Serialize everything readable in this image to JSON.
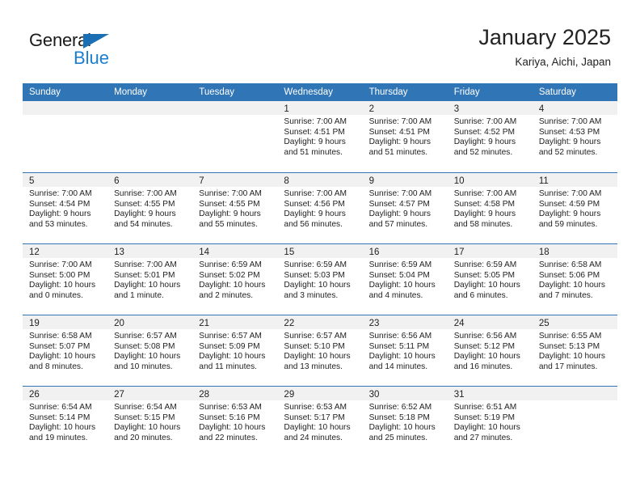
{
  "brand": {
    "name_top": "General",
    "name_bottom": "Blue",
    "accent_color": "#1b7ed1",
    "triangle_color": "#1b6fb5"
  },
  "header": {
    "title": "January 2025",
    "subtitle": "Kariya, Aichi, Japan"
  },
  "theme": {
    "header_row_bg": "#3075b5",
    "day_band_bg": "#f1f1f1",
    "row_border": "#3075b5",
    "text": "#222222"
  },
  "weekdays": [
    "Sunday",
    "Monday",
    "Tuesday",
    "Wednesday",
    "Thursday",
    "Friday",
    "Saturday"
  ],
  "weeks": [
    [
      {
        "day": "",
        "lines": []
      },
      {
        "day": "",
        "lines": []
      },
      {
        "day": "",
        "lines": []
      },
      {
        "day": "1",
        "lines": [
          "Sunrise: 7:00 AM",
          "Sunset: 4:51 PM",
          "Daylight: 9 hours",
          "and 51 minutes."
        ]
      },
      {
        "day": "2",
        "lines": [
          "Sunrise: 7:00 AM",
          "Sunset: 4:51 PM",
          "Daylight: 9 hours",
          "and 51 minutes."
        ]
      },
      {
        "day": "3",
        "lines": [
          "Sunrise: 7:00 AM",
          "Sunset: 4:52 PM",
          "Daylight: 9 hours",
          "and 52 minutes."
        ]
      },
      {
        "day": "4",
        "lines": [
          "Sunrise: 7:00 AM",
          "Sunset: 4:53 PM",
          "Daylight: 9 hours",
          "and 52 minutes."
        ]
      }
    ],
    [
      {
        "day": "5",
        "lines": [
          "Sunrise: 7:00 AM",
          "Sunset: 4:54 PM",
          "Daylight: 9 hours",
          "and 53 minutes."
        ]
      },
      {
        "day": "6",
        "lines": [
          "Sunrise: 7:00 AM",
          "Sunset: 4:55 PM",
          "Daylight: 9 hours",
          "and 54 minutes."
        ]
      },
      {
        "day": "7",
        "lines": [
          "Sunrise: 7:00 AM",
          "Sunset: 4:55 PM",
          "Daylight: 9 hours",
          "and 55 minutes."
        ]
      },
      {
        "day": "8",
        "lines": [
          "Sunrise: 7:00 AM",
          "Sunset: 4:56 PM",
          "Daylight: 9 hours",
          "and 56 minutes."
        ]
      },
      {
        "day": "9",
        "lines": [
          "Sunrise: 7:00 AM",
          "Sunset: 4:57 PM",
          "Daylight: 9 hours",
          "and 57 minutes."
        ]
      },
      {
        "day": "10",
        "lines": [
          "Sunrise: 7:00 AM",
          "Sunset: 4:58 PM",
          "Daylight: 9 hours",
          "and 58 minutes."
        ]
      },
      {
        "day": "11",
        "lines": [
          "Sunrise: 7:00 AM",
          "Sunset: 4:59 PM",
          "Daylight: 9 hours",
          "and 59 minutes."
        ]
      }
    ],
    [
      {
        "day": "12",
        "lines": [
          "Sunrise: 7:00 AM",
          "Sunset: 5:00 PM",
          "Daylight: 10 hours",
          "and 0 minutes."
        ]
      },
      {
        "day": "13",
        "lines": [
          "Sunrise: 7:00 AM",
          "Sunset: 5:01 PM",
          "Daylight: 10 hours",
          "and 1 minute."
        ]
      },
      {
        "day": "14",
        "lines": [
          "Sunrise: 6:59 AM",
          "Sunset: 5:02 PM",
          "Daylight: 10 hours",
          "and 2 minutes."
        ]
      },
      {
        "day": "15",
        "lines": [
          "Sunrise: 6:59 AM",
          "Sunset: 5:03 PM",
          "Daylight: 10 hours",
          "and 3 minutes."
        ]
      },
      {
        "day": "16",
        "lines": [
          "Sunrise: 6:59 AM",
          "Sunset: 5:04 PM",
          "Daylight: 10 hours",
          "and 4 minutes."
        ]
      },
      {
        "day": "17",
        "lines": [
          "Sunrise: 6:59 AM",
          "Sunset: 5:05 PM",
          "Daylight: 10 hours",
          "and 6 minutes."
        ]
      },
      {
        "day": "18",
        "lines": [
          "Sunrise: 6:58 AM",
          "Sunset: 5:06 PM",
          "Daylight: 10 hours",
          "and 7 minutes."
        ]
      }
    ],
    [
      {
        "day": "19",
        "lines": [
          "Sunrise: 6:58 AM",
          "Sunset: 5:07 PM",
          "Daylight: 10 hours",
          "and 8 minutes."
        ]
      },
      {
        "day": "20",
        "lines": [
          "Sunrise: 6:57 AM",
          "Sunset: 5:08 PM",
          "Daylight: 10 hours",
          "and 10 minutes."
        ]
      },
      {
        "day": "21",
        "lines": [
          "Sunrise: 6:57 AM",
          "Sunset: 5:09 PM",
          "Daylight: 10 hours",
          "and 11 minutes."
        ]
      },
      {
        "day": "22",
        "lines": [
          "Sunrise: 6:57 AM",
          "Sunset: 5:10 PM",
          "Daylight: 10 hours",
          "and 13 minutes."
        ]
      },
      {
        "day": "23",
        "lines": [
          "Sunrise: 6:56 AM",
          "Sunset: 5:11 PM",
          "Daylight: 10 hours",
          "and 14 minutes."
        ]
      },
      {
        "day": "24",
        "lines": [
          "Sunrise: 6:56 AM",
          "Sunset: 5:12 PM",
          "Daylight: 10 hours",
          "and 16 minutes."
        ]
      },
      {
        "day": "25",
        "lines": [
          "Sunrise: 6:55 AM",
          "Sunset: 5:13 PM",
          "Daylight: 10 hours",
          "and 17 minutes."
        ]
      }
    ],
    [
      {
        "day": "26",
        "lines": [
          "Sunrise: 6:54 AM",
          "Sunset: 5:14 PM",
          "Daylight: 10 hours",
          "and 19 minutes."
        ]
      },
      {
        "day": "27",
        "lines": [
          "Sunrise: 6:54 AM",
          "Sunset: 5:15 PM",
          "Daylight: 10 hours",
          "and 20 minutes."
        ]
      },
      {
        "day": "28",
        "lines": [
          "Sunrise: 6:53 AM",
          "Sunset: 5:16 PM",
          "Daylight: 10 hours",
          "and 22 minutes."
        ]
      },
      {
        "day": "29",
        "lines": [
          "Sunrise: 6:53 AM",
          "Sunset: 5:17 PM",
          "Daylight: 10 hours",
          "and 24 minutes."
        ]
      },
      {
        "day": "30",
        "lines": [
          "Sunrise: 6:52 AM",
          "Sunset: 5:18 PM",
          "Daylight: 10 hours",
          "and 25 minutes."
        ]
      },
      {
        "day": "31",
        "lines": [
          "Sunrise: 6:51 AM",
          "Sunset: 5:19 PM",
          "Daylight: 10 hours",
          "and 27 minutes."
        ]
      },
      {
        "day": "",
        "lines": []
      }
    ]
  ]
}
